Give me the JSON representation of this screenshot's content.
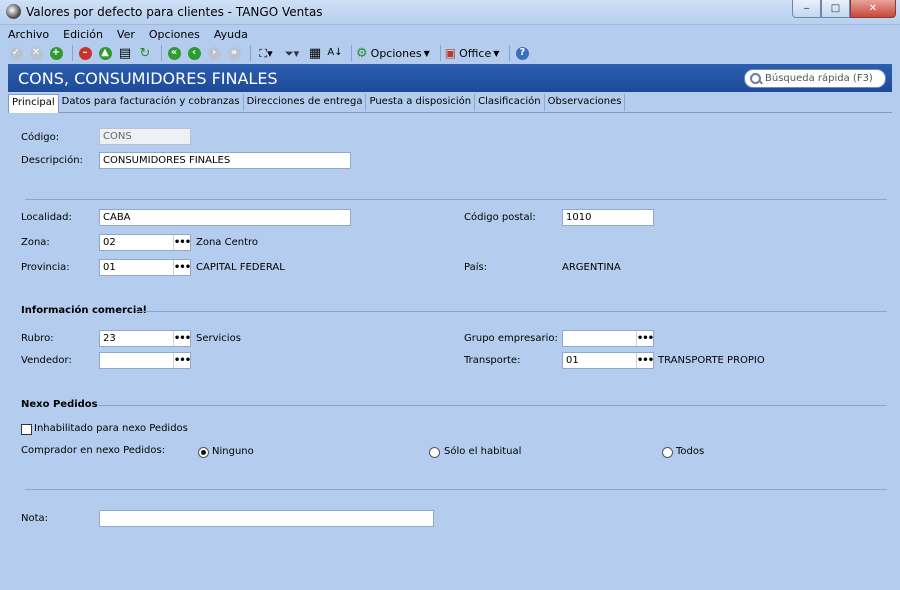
{
  "window": {
    "title": "Valores por defecto para clientes - TANGO Ventas",
    "min": "‒",
    "max": "□",
    "close": "✕"
  },
  "menu": [
    "Archivo",
    "Edición",
    "Ver",
    "Opciones",
    "Ayuda"
  ],
  "toolbar": {
    "opciones_label": "Opciones",
    "office_label": "Office"
  },
  "header": {
    "title": "CONS, CONSUMIDORES FINALES",
    "search_placeholder": "Búsqueda rápida (F3)"
  },
  "tabs": [
    "Principal",
    "Datos para facturación y cobranzas",
    "Direcciones de entrega",
    "Puesta a disposición",
    "Clasificación",
    "Observaciones"
  ],
  "form": {
    "codigo_label": "Código:",
    "codigo_value": "CONS",
    "descripcion_label": "Descripción:",
    "descripcion_value": "CONSUMIDORES FINALES",
    "localidad_label": "Localidad:",
    "localidad_value": "CABA",
    "codigo_postal_label": "Código postal:",
    "codigo_postal_value": "1010",
    "zona_label": "Zona:",
    "zona_value": "02",
    "zona_desc": "Zona Centro",
    "provincia_label": "Provincia:",
    "provincia_value": "01",
    "provincia_desc": "CAPITAL FEDERAL",
    "pais_label": "País:",
    "pais_value": "ARGENTINA",
    "info_comercial_title": "Información comercial",
    "rubro_label": "Rubro:",
    "rubro_value": "23",
    "rubro_desc": "Servicios",
    "grupo_label": "Grupo empresario:",
    "grupo_value": "",
    "vendedor_label": "Vendedor:",
    "vendedor_value": "",
    "transporte_label": "Transporte:",
    "transporte_value": "01",
    "transporte_desc": "TRANSPORTE PROPIO",
    "nexo_title": "Nexo Pedidos",
    "inhabilitado_label": "Inhabilitado para nexo Pedidos",
    "comprador_label": "Comprador en nexo Pedidos:",
    "radio_ninguno": "Ninguno",
    "radio_habitual": "Sólo el habitual",
    "radio_todos": "Todos",
    "nota_label": "Nota:",
    "nota_value": "",
    "lookup_dots": "•••"
  }
}
